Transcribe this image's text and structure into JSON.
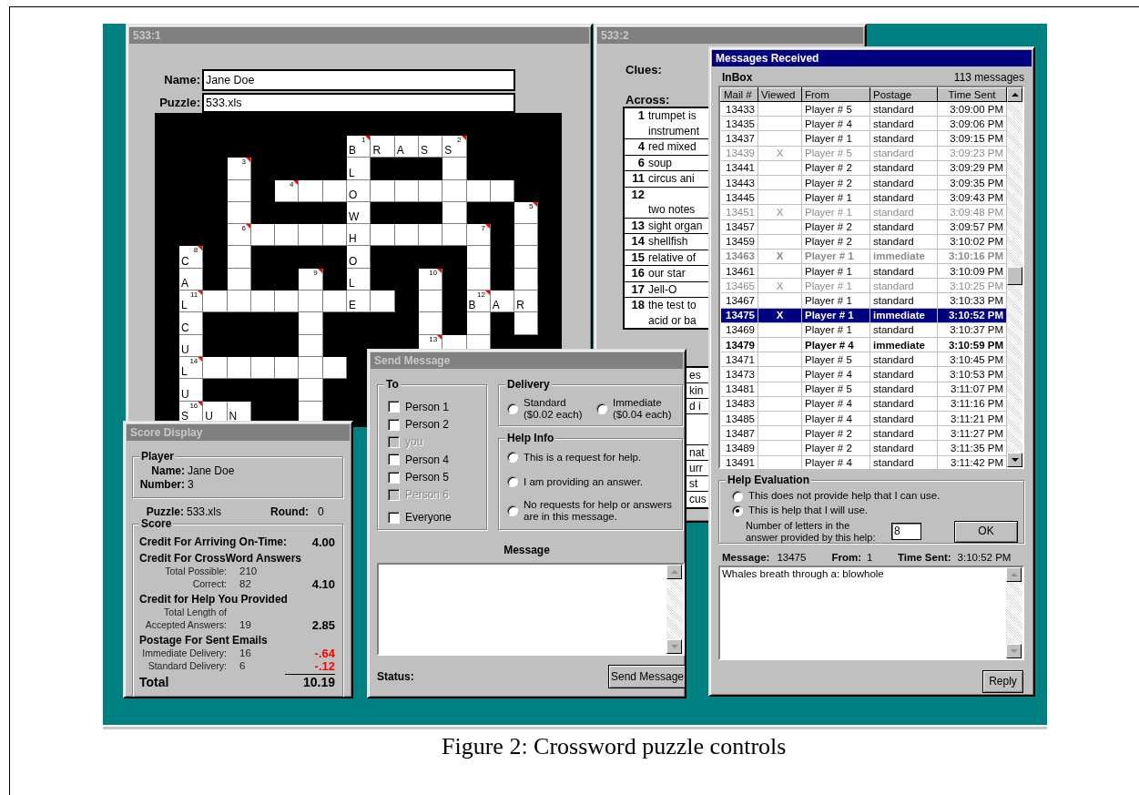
{
  "puzzle_window": {
    "title": "533:1",
    "active": false,
    "name_label": "Name:",
    "name": "Jane Doe",
    "puzzle_label": "Puzzle:",
    "puzzle": "533.xls",
    "crossword": {
      "rows": [
        [
          {
            "kind": "block"
          },
          {
            "kind": "block"
          },
          {
            "kind": "block"
          },
          {
            "kind": "block"
          },
          {
            "kind": "block"
          },
          {
            "kind": "block"
          },
          {
            "kind": "block"
          },
          {
            "kind": "open",
            "letter": "B",
            "number": "1"
          },
          {
            "kind": "open",
            "letter": "R"
          },
          {
            "kind": "open",
            "letter": "A"
          },
          {
            "kind": "open",
            "letter": "S"
          },
          {
            "kind": "open",
            "letter": "S",
            "number": "2"
          },
          {
            "kind": "block"
          },
          {
            "kind": "block"
          },
          {
            "kind": "block"
          }
        ],
        [
          {
            "kind": "block"
          },
          {
            "kind": "block"
          },
          {
            "kind": "open",
            "number": "3"
          },
          {
            "kind": "block"
          },
          {
            "kind": "block"
          },
          {
            "kind": "block"
          },
          {
            "kind": "block"
          },
          {
            "kind": "open",
            "letter": "L"
          },
          {
            "kind": "block"
          },
          {
            "kind": "block"
          },
          {
            "kind": "block"
          },
          {
            "kind": "open"
          },
          {
            "kind": "block"
          },
          {
            "kind": "block"
          },
          {
            "kind": "block"
          }
        ],
        [
          {
            "kind": "block"
          },
          {
            "kind": "block"
          },
          {
            "kind": "open"
          },
          {
            "kind": "block"
          },
          {
            "kind": "open",
            "number": "4"
          },
          {
            "kind": "open"
          },
          {
            "kind": "open"
          },
          {
            "kind": "open",
            "letter": "O"
          },
          {
            "kind": "open"
          },
          {
            "kind": "open"
          },
          {
            "kind": "open"
          },
          {
            "kind": "open"
          },
          {
            "kind": "open"
          },
          {
            "kind": "open"
          },
          {
            "kind": "block"
          }
        ],
        [
          {
            "kind": "block"
          },
          {
            "kind": "block"
          },
          {
            "kind": "open"
          },
          {
            "kind": "block"
          },
          {
            "kind": "block"
          },
          {
            "kind": "block"
          },
          {
            "kind": "block"
          },
          {
            "kind": "open",
            "letter": "W"
          },
          {
            "kind": "block"
          },
          {
            "kind": "block"
          },
          {
            "kind": "block"
          },
          {
            "kind": "open"
          },
          {
            "kind": "block"
          },
          {
            "kind": "block"
          },
          {
            "kind": "open",
            "number": "5"
          }
        ],
        [
          {
            "kind": "block"
          },
          {
            "kind": "block"
          },
          {
            "kind": "open",
            "number": "6"
          },
          {
            "kind": "open"
          },
          {
            "kind": "open"
          },
          {
            "kind": "open"
          },
          {
            "kind": "open"
          },
          {
            "kind": "open",
            "letter": "H"
          },
          {
            "kind": "open"
          },
          {
            "kind": "open"
          },
          {
            "kind": "open"
          },
          {
            "kind": "open"
          },
          {
            "kind": "open",
            "number": "7"
          },
          {
            "kind": "block"
          },
          {
            "kind": "open"
          }
        ],
        [
          {
            "kind": "open",
            "letter": "C",
            "number": "8"
          },
          {
            "kind": "block"
          },
          {
            "kind": "open"
          },
          {
            "kind": "block"
          },
          {
            "kind": "block"
          },
          {
            "kind": "block"
          },
          {
            "kind": "block"
          },
          {
            "kind": "open",
            "letter": "O"
          },
          {
            "kind": "block"
          },
          {
            "kind": "block"
          },
          {
            "kind": "block"
          },
          {
            "kind": "block"
          },
          {
            "kind": "open"
          },
          {
            "kind": "block"
          },
          {
            "kind": "open"
          }
        ],
        [
          {
            "kind": "open",
            "letter": "A"
          },
          {
            "kind": "block"
          },
          {
            "kind": "open"
          },
          {
            "kind": "block"
          },
          {
            "kind": "block"
          },
          {
            "kind": "open",
            "number": "9"
          },
          {
            "kind": "block"
          },
          {
            "kind": "open",
            "letter": "L"
          },
          {
            "kind": "block"
          },
          {
            "kind": "block"
          },
          {
            "kind": "open",
            "number": "10"
          },
          {
            "kind": "block"
          },
          {
            "kind": "open"
          },
          {
            "kind": "block"
          },
          {
            "kind": "open"
          }
        ],
        [
          {
            "kind": "open",
            "letter": "L",
            "number": "11"
          },
          {
            "kind": "open"
          },
          {
            "kind": "open"
          },
          {
            "kind": "open"
          },
          {
            "kind": "open"
          },
          {
            "kind": "open"
          },
          {
            "kind": "open"
          },
          {
            "kind": "open",
            "letter": "E"
          },
          {
            "kind": "open"
          },
          {
            "kind": "block"
          },
          {
            "kind": "open"
          },
          {
            "kind": "block"
          },
          {
            "kind": "open",
            "letter": "B",
            "number": "12"
          },
          {
            "kind": "open",
            "letter": "A"
          },
          {
            "kind": "open",
            "letter": "R"
          }
        ],
        [
          {
            "kind": "open",
            "letter": "C"
          },
          {
            "kind": "block"
          },
          {
            "kind": "block"
          },
          {
            "kind": "block"
          },
          {
            "kind": "block"
          },
          {
            "kind": "open"
          },
          {
            "kind": "block"
          },
          {
            "kind": "block"
          },
          {
            "kind": "block"
          },
          {
            "kind": "block"
          },
          {
            "kind": "open"
          },
          {
            "kind": "block"
          },
          {
            "kind": "open"
          },
          {
            "kind": "block"
          },
          {
            "kind": "open"
          }
        ],
        [
          {
            "kind": "open",
            "letter": "U"
          },
          {
            "kind": "block"
          },
          {
            "kind": "block"
          },
          {
            "kind": "block"
          },
          {
            "kind": "block"
          },
          {
            "kind": "open"
          },
          {
            "kind": "block"
          },
          {
            "kind": "block"
          },
          {
            "kind": "block"
          },
          {
            "kind": "block"
          },
          {
            "kind": "open",
            "number": "13"
          },
          {
            "kind": "open"
          },
          {
            "kind": "open"
          },
          {
            "kind": "block"
          },
          {
            "kind": "block"
          }
        ],
        [
          {
            "kind": "open",
            "letter": "L",
            "number": "14"
          },
          {
            "kind": "open"
          },
          {
            "kind": "open"
          },
          {
            "kind": "open"
          },
          {
            "kind": "open"
          },
          {
            "kind": "open"
          },
          {
            "kind": "open"
          },
          {
            "kind": "block"
          }
        ],
        [
          {
            "kind": "open",
            "letter": "U"
          },
          {
            "kind": "block"
          },
          {
            "kind": "block"
          },
          {
            "kind": "block"
          },
          {
            "kind": "block"
          },
          {
            "kind": "open"
          },
          {
            "kind": "block"
          },
          {
            "kind": "block"
          }
        ],
        [
          {
            "kind": "open",
            "letter": "S",
            "number": "16"
          },
          {
            "kind": "open",
            "letter": "U"
          },
          {
            "kind": "open",
            "letter": "N"
          },
          {
            "kind": "block"
          },
          {
            "kind": "block"
          },
          {
            "kind": "open"
          },
          {
            "kind": "block"
          },
          {
            "kind": "block"
          }
        ]
      ]
    }
  },
  "clues_window": {
    "title": "533:2",
    "active": false,
    "clues_label": "Clues:",
    "across_label": "Across:",
    "across_clues": [
      {
        "number": "1",
        "lines": [
          "trumpet is",
          "instrument"
        ],
        "blank_first_line": false
      },
      {
        "number": "4",
        "lines": [
          "red mixed"
        ],
        "blank_first_line": false
      },
      {
        "number": "6",
        "lines": [
          "soup"
        ],
        "blank_first_line": false
      },
      {
        "number": "11",
        "lines": [
          "circus ani"
        ],
        "blank_first_line": false
      },
      {
        "number": "12",
        "lines": [
          "two notes"
        ],
        "blank_first_line": true
      },
      {
        "number": "13",
        "lines": [
          "sight organ"
        ],
        "blank_first_line": false
      },
      {
        "number": "14",
        "lines": [
          "shellfish"
        ],
        "blank_first_line": false
      },
      {
        "number": "15",
        "lines": [
          "relative of"
        ],
        "blank_first_line": false
      },
      {
        "number": "16",
        "lines": [
          "our star"
        ],
        "blank_first_line": false
      },
      {
        "number": "17",
        "lines": [
          "Jell-O"
        ],
        "blank_first_line": false
      },
      {
        "number": "18",
        "lines": [
          "the test to",
          "acid or ba"
        ],
        "blank_first_line": false
      }
    ],
    "down_clue_fragments": [
      {
        "text": "es",
        "blank": false
      },
      {
        "text": "kin",
        "blank": false
      },
      {
        "text": "d i",
        "blank": false
      },
      {
        "blank": true
      },
      {
        "text": "nat",
        "blank": false
      },
      {
        "text": "urr",
        "blank": false
      },
      {
        "text": "st",
        "blank": false
      },
      {
        "text": "cus",
        "blank": false
      }
    ]
  },
  "messages_window": {
    "title": "Messages Received",
    "active": true,
    "inbox_label": "InBox",
    "message_count": "113  messages",
    "columns": [
      "Mail #",
      "Viewed",
      "From",
      "Postage",
      "Time Sent"
    ],
    "messages": [
      {
        "mail": "13433",
        "from": "Player # 5",
        "postage": "standard",
        "time": "3:09:00 PM",
        "read": false,
        "bold": false,
        "selected": false
      },
      {
        "mail": "13435",
        "from": "Player # 4",
        "postage": "standard",
        "time": "3:09:06 PM",
        "read": false,
        "bold": false,
        "selected": false
      },
      {
        "mail": "13437",
        "from": "Player # 1",
        "postage": "standard",
        "time": "3:09:15 PM",
        "read": false,
        "bold": false,
        "selected": false
      },
      {
        "mail": "13439",
        "viewed": "X",
        "from": "Player # 5",
        "postage": "standard",
        "time": "3:09:23 PM",
        "read": true,
        "bold": false,
        "selected": false
      },
      {
        "mail": "13441",
        "from": "Player # 2",
        "postage": "standard",
        "time": "3:09:29 PM",
        "read": false,
        "bold": false,
        "selected": false
      },
      {
        "mail": "13443",
        "from": "Player # 2",
        "postage": "standard",
        "time": "3:09:35 PM",
        "read": false,
        "bold": false,
        "selected": false
      },
      {
        "mail": "13445",
        "from": "Player # 1",
        "postage": "standard",
        "time": "3:09:43 PM",
        "read": false,
        "bold": false,
        "selected": false
      },
      {
        "mail": "13451",
        "viewed": "X",
        "from": "Player # 1",
        "postage": "standard",
        "time": "3:09:48 PM",
        "read": true,
        "bold": false,
        "selected": false
      },
      {
        "mail": "13457",
        "from": "Player # 2",
        "postage": "standard",
        "time": "3:09:57 PM",
        "read": false,
        "bold": false,
        "selected": false
      },
      {
        "mail": "13459",
        "from": "Player # 2",
        "postage": "standard",
        "time": "3:10:02 PM",
        "read": false,
        "bold": false,
        "selected": false
      },
      {
        "mail": "13463",
        "viewed": "X",
        "from": "Player # 1",
        "postage": "immediate",
        "time": "3:10:16 PM",
        "read": true,
        "bold": true,
        "selected": false
      },
      {
        "mail": "13461",
        "from": "Player # 1",
        "postage": "standard",
        "time": "3:10:09 PM",
        "read": false,
        "bold": false,
        "selected": false
      },
      {
        "mail": "13465",
        "viewed": "X",
        "from": "Player # 1",
        "postage": "standard",
        "time": "3:10:25 PM",
        "read": true,
        "bold": false,
        "selected": false
      },
      {
        "mail": "13467",
        "from": "Player # 1",
        "postage": "standard",
        "time": "3:10:33 PM",
        "read": false,
        "bold": false,
        "selected": false
      },
      {
        "mail": "13475",
        "viewed": "X",
        "from": "Player # 1",
        "postage": "immediate",
        "time": "3:10:52 PM",
        "bold": true,
        "selected": true
      },
      {
        "mail": "13469",
        "from": "Player # 1",
        "postage": "standard",
        "time": "3:10:37 PM",
        "read": false,
        "bold": false,
        "selected": false
      },
      {
        "mail": "13479",
        "from": "Player # 4",
        "postage": "immediate",
        "time": "3:10:59 PM",
        "read": false,
        "bold": true,
        "selected": false
      },
      {
        "mail": "13471",
        "from": "Player # 5",
        "postage": "standard",
        "time": "3:10:45 PM",
        "read": false,
        "bold": false,
        "selected": false
      },
      {
        "mail": "13473",
        "from": "Player # 4",
        "postage": "standard",
        "time": "3:10:53 PM",
        "read": false,
        "bold": false,
        "selected": false
      },
      {
        "mail": "13481",
        "from": "Player # 5",
        "postage": "standard",
        "time": "3:11:07 PM",
        "read": false,
        "bold": false,
        "selected": false
      },
      {
        "mail": "13483",
        "from": "Player # 4",
        "postage": "standard",
        "time": "3:11:16 PM",
        "read": false,
        "bold": false,
        "selected": false
      },
      {
        "mail": "13485",
        "from": "Player # 4",
        "postage": "standard",
        "time": "3:11:21 PM",
        "read": false,
        "bold": false,
        "selected": false
      },
      {
        "mail": "13487",
        "from": "Player # 2",
        "postage": "standard",
        "time": "3:11:27 PM",
        "read": false,
        "bold": false,
        "selected": false
      },
      {
        "mail": "13489",
        "from": "Player # 2",
        "postage": "standard",
        "time": "3:11:35 PM",
        "read": false,
        "bold": false,
        "selected": false
      },
      {
        "mail": "13491",
        "from": "Player # 4",
        "postage": "standard",
        "time": "3:11:42 PM",
        "read": false,
        "bold": false,
        "selected": false
      }
    ],
    "help_evaluation": {
      "legend": "Help Evaluation",
      "options": [
        {
          "label": "This does not provide help that I can use.",
          "selected": false
        },
        {
          "label": "This is help that I will use.",
          "selected": true
        }
      ],
      "letters_label": "Number of letters in the answer provided by this help:",
      "letters_value": "8",
      "ok_button": "OK"
    },
    "message_label": "Message:",
    "message_id": "13475",
    "from_label": "From:",
    "from": "1",
    "time_label": "Time Sent:",
    "time": "3:10:52 PM",
    "message_body": "Whales breath through a: blowhole",
    "reply_button": "Reply"
  },
  "send_message_window": {
    "title": "Send Message",
    "active": false,
    "to": {
      "legend": "To",
      "recipients": [
        {
          "label": "Person 1",
          "checked": false,
          "disabled": false
        },
        {
          "label": "Person 2",
          "checked": false,
          "disabled": false
        },
        {
          "label": "you",
          "checked": false,
          "disabled": true
        },
        {
          "label": "Person 4",
          "checked": false,
          "disabled": false
        },
        {
          "label": "Person 5",
          "checked": false,
          "disabled": false
        },
        {
          "label": "Person 6",
          "checked": false,
          "disabled": true
        },
        {
          "label": "Everyone",
          "checked": false,
          "disabled": false
        }
      ]
    },
    "delivery": {
      "legend": "Delivery",
      "options": [
        {
          "label": "Standard ($0.02 each)",
          "selected": false
        },
        {
          "label": "Immediate ($0.04 each)",
          "selected": false
        }
      ]
    },
    "help_info": {
      "legend": "Help Info",
      "options": [
        {
          "label": "This is a request for help.",
          "selected": false
        },
        {
          "label": "I am providing an answer.",
          "selected": false
        },
        {
          "label": "No requests for help or answers are in this message.",
          "selected": false
        }
      ]
    },
    "message_label": "Message",
    "status_label": "Status:",
    "send_button": "Send Message"
  },
  "score_window": {
    "title": "Score Display",
    "active": false,
    "player": {
      "legend": "Player",
      "name_label": "Name:",
      "name": "Jane Doe",
      "number_label": "Number:",
      "number": "3"
    },
    "puzzle_label": "Puzzle:",
    "puzzle": "533.xls",
    "round_label": "Round:",
    "round": "0",
    "score": {
      "legend": "Score",
      "sections": [
        {
          "heading": "Credit For Arriving On-Time:",
          "value": "4.00"
        },
        {
          "heading": "Credit For CrossWord Answers",
          "lines": [
            {
              "label": "Total Possible:",
              "count": "210"
            },
            {
              "label": "Correct:",
              "count": "82",
              "value": "4.10",
              "negative": false
            }
          ]
        },
        {
          "heading": "Credit for Help You Provided",
          "lines": [
            {
              "label": "Total Length of"
            },
            {
              "label": "Accepted Answers:",
              "count": "19",
              "value": "2.85",
              "negative": false
            }
          ]
        },
        {
          "heading": "Postage For Sent Emails",
          "lines": [
            {
              "label": "Immediate Delivery:",
              "count": "16",
              "value": "-.64",
              "negative": true
            },
            {
              "label": "Standard Delivery:",
              "count": "6",
              "value": "-.12",
              "negative": true
            }
          ]
        }
      ],
      "total_label": "Total",
      "total": "10.19"
    }
  },
  "caption": "Figure 2: Crossword puzzle controls"
}
